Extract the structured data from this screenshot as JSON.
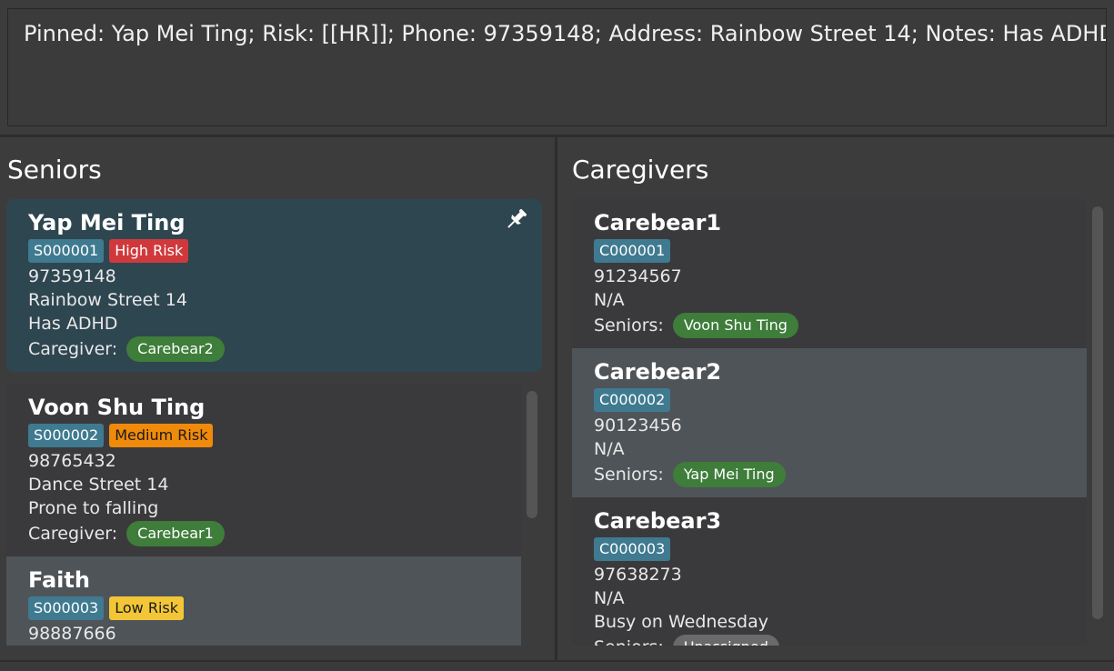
{
  "result": {
    "text": "Pinned: Yap Mei Ting; Risk: [[HR]]; Phone: 97359148; Address: Rainbow Street 14; Notes: Has ADHD"
  },
  "seniors": {
    "title": "Seniors",
    "pinned": {
      "name": "Yap Mei Ting",
      "id": "S000001",
      "risk": "High Risk",
      "phone": "97359148",
      "address": "Rainbow Street 14",
      "notes": "Has ADHD",
      "caregiver_label": "Caregiver:",
      "caregiver": "Carebear2",
      "pin_icon": "pin-icon"
    },
    "items": [
      {
        "name": "Voon Shu Ting",
        "id": "S000002",
        "risk": "Medium Risk",
        "phone": "98765432",
        "address": "Dance Street 14",
        "notes": "Prone to falling",
        "caregiver_label": "Caregiver:",
        "caregiver": "Carebear1"
      },
      {
        "name": "Faith",
        "id": "S000003",
        "risk": "Low Risk",
        "phone": "98887666"
      }
    ]
  },
  "caregivers": {
    "title": "Caregivers",
    "items": [
      {
        "name": "Carebear1",
        "id": "C000001",
        "phone": "91234567",
        "address": "N/A",
        "seniors_label": "Seniors:",
        "senior": "Voon Shu Ting"
      },
      {
        "name": "Carebear2",
        "id": "C000002",
        "phone": "90123456",
        "address": "N/A",
        "seniors_label": "Seniors:",
        "senior": "Yap Mei Ting"
      },
      {
        "name": "Carebear3",
        "id": "C000003",
        "phone": "97638273",
        "address": "N/A",
        "notes": "Busy on Wednesday",
        "seniors_label": "Seniors:",
        "senior": "Unassigned"
      }
    ]
  },
  "colors": {
    "background": "#3c3c3d",
    "pinned_card": "#2e4650",
    "selected_card": "#4f5458",
    "high_risk": "#d0393c",
    "medium_risk": "#f08a0a",
    "low_risk": "#f2c637",
    "id_tag": "#3f7a90",
    "assigned_pill": "#3e7d3a"
  }
}
